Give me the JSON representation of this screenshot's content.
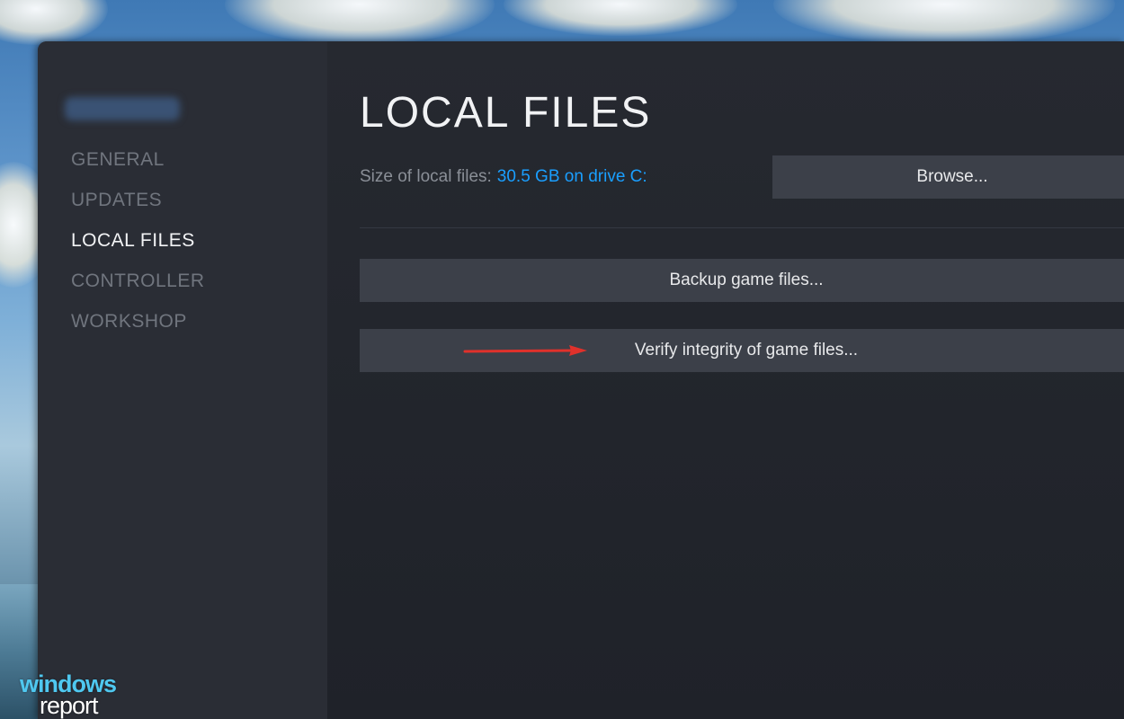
{
  "sidebar": {
    "items": [
      {
        "label": "GENERAL",
        "active": false
      },
      {
        "label": "UPDATES",
        "active": false
      },
      {
        "label": "LOCAL FILES",
        "active": true
      },
      {
        "label": "CONTROLLER",
        "active": false
      },
      {
        "label": "WORKSHOP",
        "active": false
      }
    ]
  },
  "main": {
    "title": "LOCAL FILES",
    "size_label": "Size of local files:",
    "size_value": "30.5 GB on drive C:",
    "browse_label": "Browse...",
    "backup_label": "Backup game files...",
    "verify_label": "Verify integrity of game files..."
  },
  "annotation": {
    "arrow_color": "#e0312b",
    "arrow_icon": "arrow-right-icon"
  },
  "watermark": {
    "line1": "windows",
    "line2": "report"
  },
  "colors": {
    "accent_link": "#1a9fff",
    "window_bg": "#23262e",
    "sidebar_bg": "#2a2d35",
    "button_bg": "#3c4049"
  }
}
